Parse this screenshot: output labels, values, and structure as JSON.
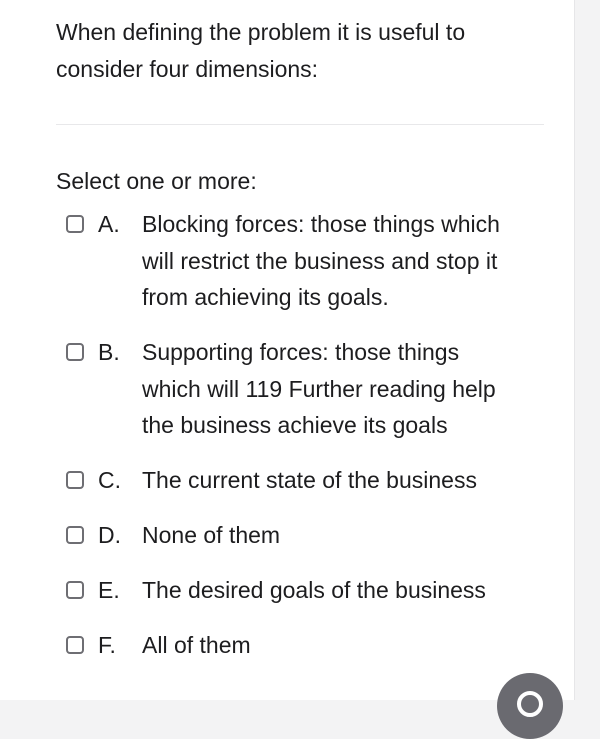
{
  "question": {
    "line1": "When defining the problem it is useful to",
    "line2": "consider four dimensions:"
  },
  "prompt": "Select one or more:",
  "options": [
    {
      "letter": "A.",
      "lines": [
        "Blocking forces: those things which",
        "will restrict the business and stop it",
        "from achieving its goals."
      ]
    },
    {
      "letter": "B.",
      "lines": [
        "Supporting forces: those things",
        "which will 119 Further reading help",
        "the business achieve its goals"
      ]
    },
    {
      "letter": "C.",
      "lines": [
        "The current state of the business"
      ]
    },
    {
      "letter": "D.",
      "lines": [
        "None of them"
      ]
    },
    {
      "letter": "E.",
      "lines": [
        "The desired goals of the business"
      ]
    },
    {
      "letter": "F.",
      "lines": [
        "All of them"
      ]
    }
  ],
  "colors": {
    "background": "#f3f3f4",
    "card": "#ffffff",
    "text": "#1d1d1f",
    "checkbox_border": "#6e6e73",
    "fab": "#6a6a70"
  },
  "icons": {
    "fab": "chat-icon"
  }
}
